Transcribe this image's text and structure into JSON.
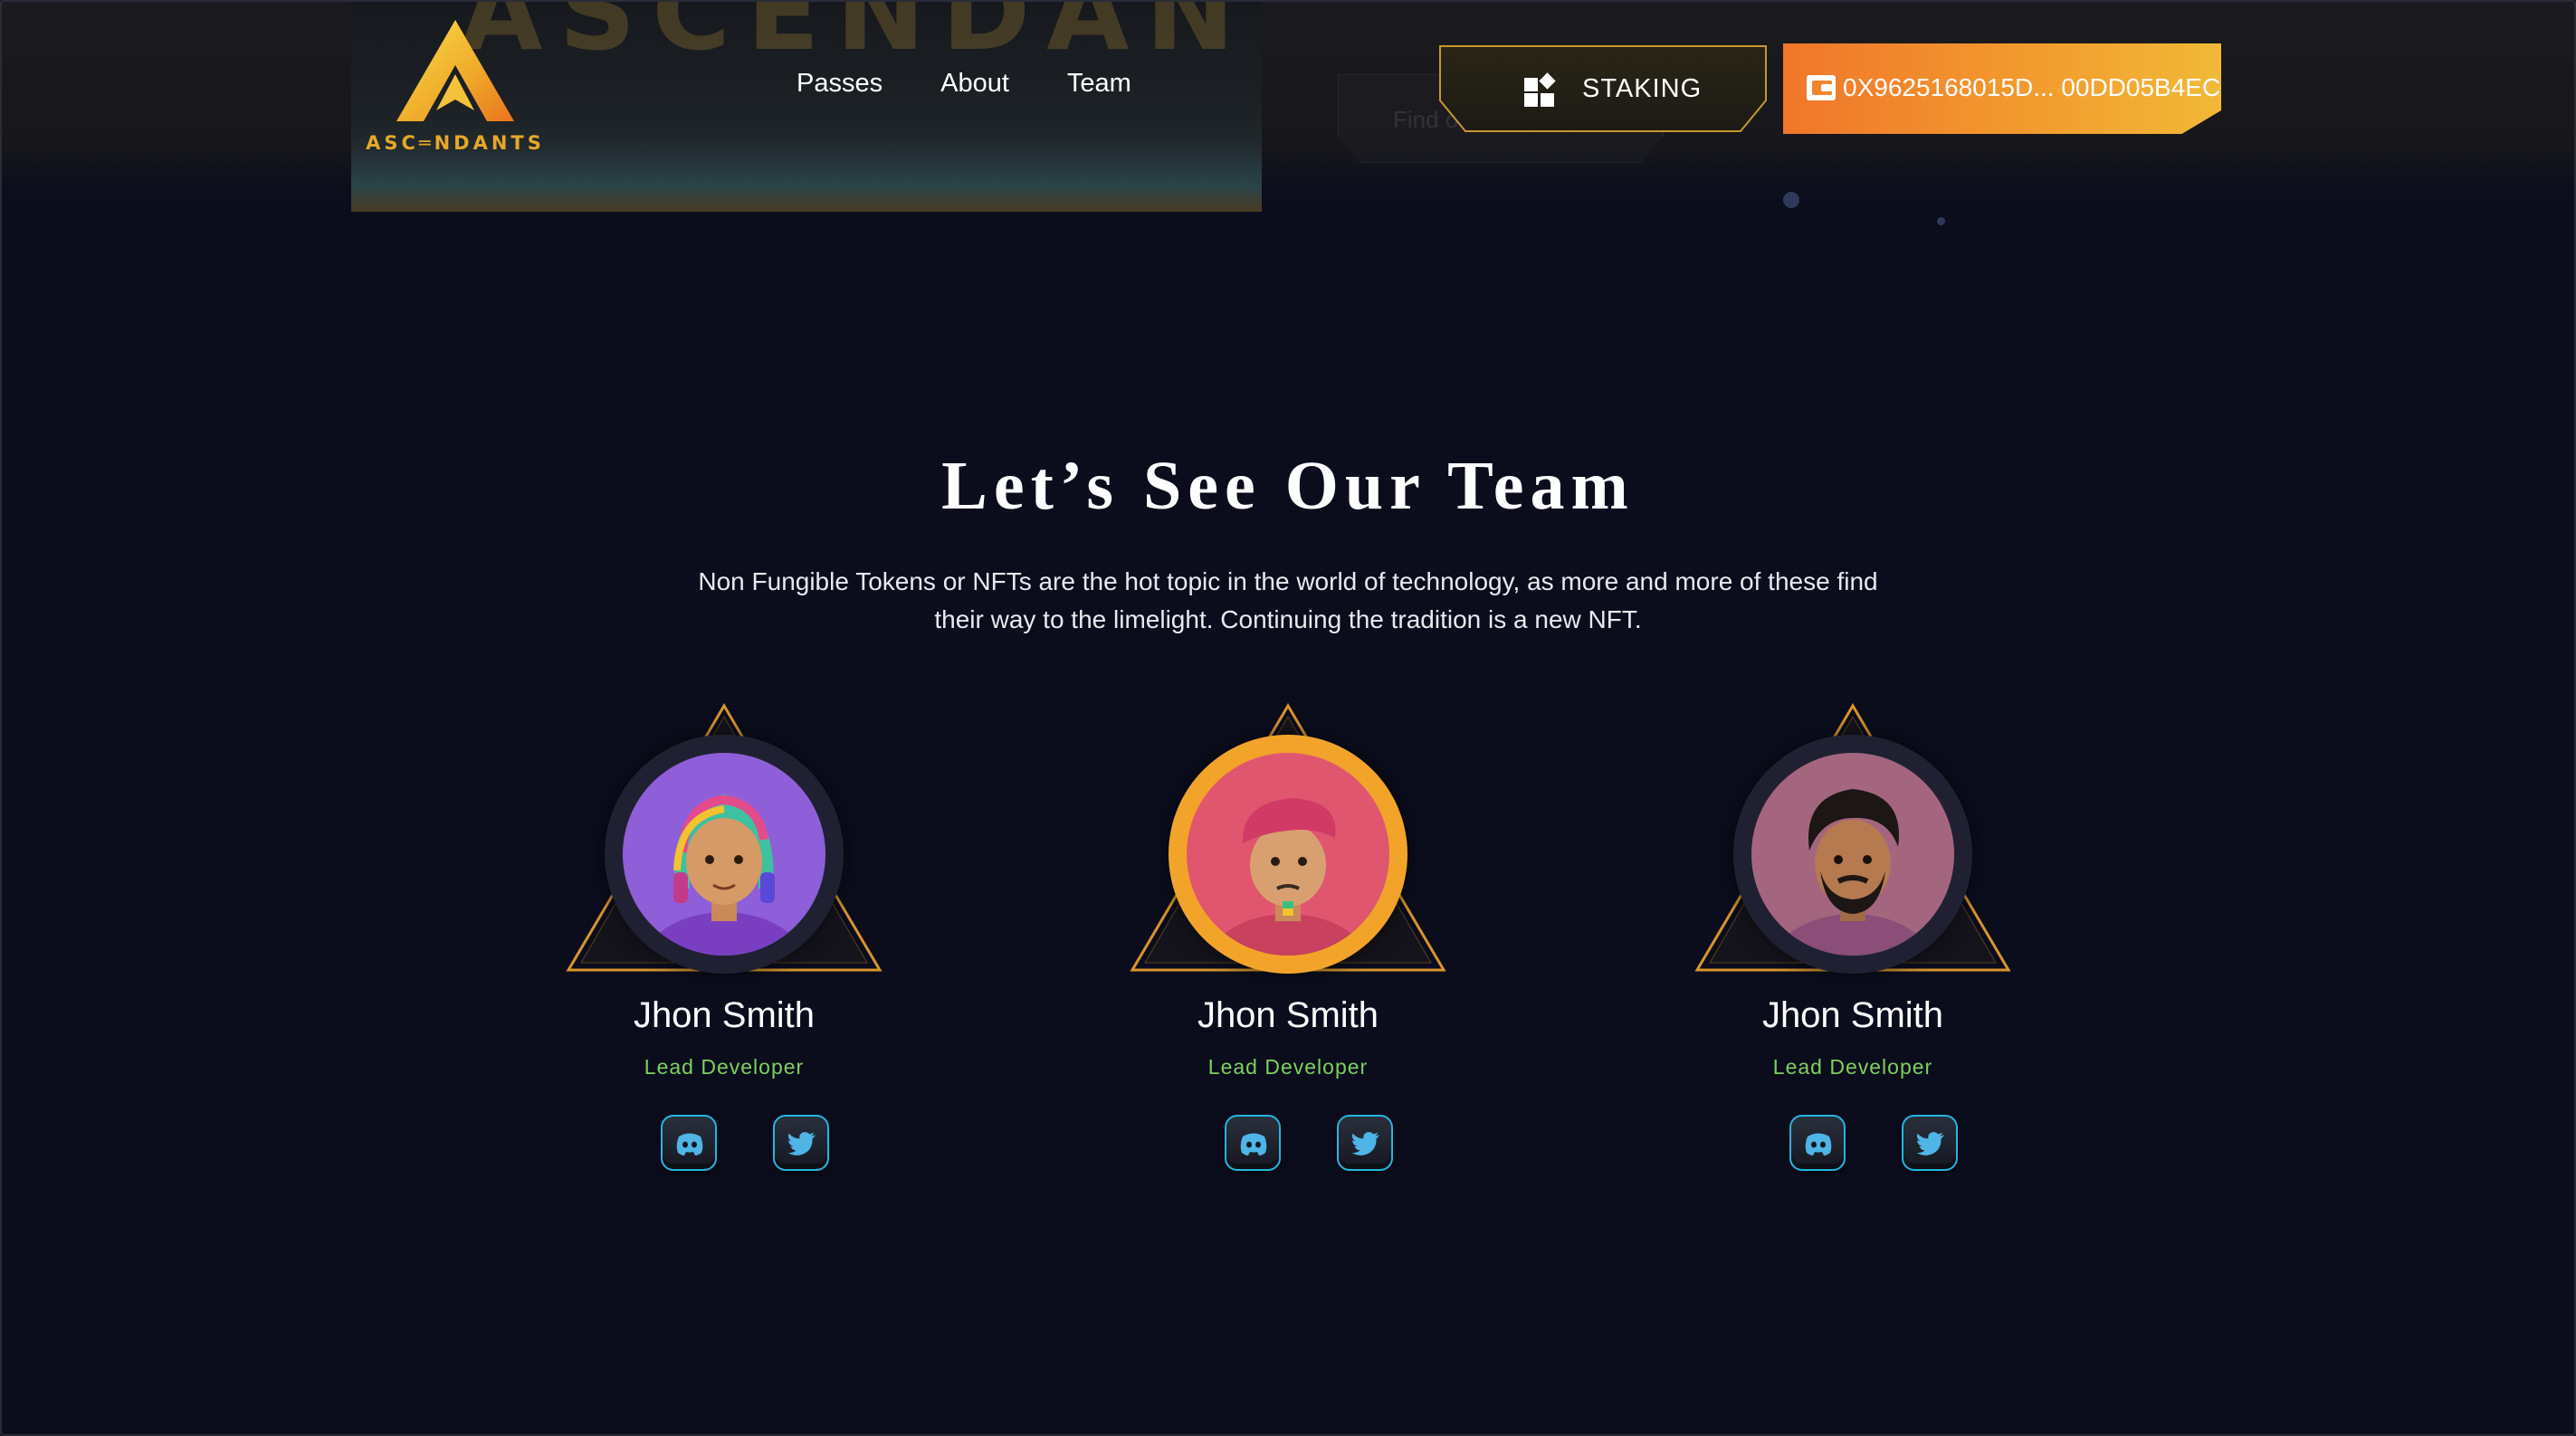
{
  "header": {
    "hero_text": "ASCENDANTS",
    "logo_text": "ASC═NDANTS",
    "nav": [
      {
        "label": "Passes"
      },
      {
        "label": "About"
      },
      {
        "label": "Team"
      }
    ],
    "ghost_button_label": "Find out more",
    "staking_label": "STAKING",
    "wallet_address": "0X9625168015D... 00DD05B4EC"
  },
  "team": {
    "title": "Let’s See Our Team",
    "description": "Non Fungible Tokens or NFTs are the hot topic in the world of technology, as more and more of these find their way to the limelight. Continuing the tradition is a new NFT.",
    "members": [
      {
        "name": "Jhon Smith",
        "role": "Lead Developer",
        "avatar_icon": "avatar-girl-rainbow-hair-icon",
        "avatar_color": "#8e5fd8"
      },
      {
        "name": "Jhon Smith",
        "role": "Lead Developer",
        "avatar_icon": "avatar-boy-pink-beret-icon",
        "avatar_color": "#e0566e"
      },
      {
        "name": "Jhon Smith",
        "role": "Lead Developer",
        "avatar_icon": "avatar-man-beard-icon",
        "avatar_color": "#a4667e"
      }
    ]
  },
  "colors": {
    "background": "#0b0d1d",
    "accent_gold": "#e6a72a",
    "wallet_gradient_start": "#f0762a",
    "wallet_gradient_end": "#f1b937",
    "role_green": "#7ed05f",
    "social_border": "#22b6e0"
  }
}
